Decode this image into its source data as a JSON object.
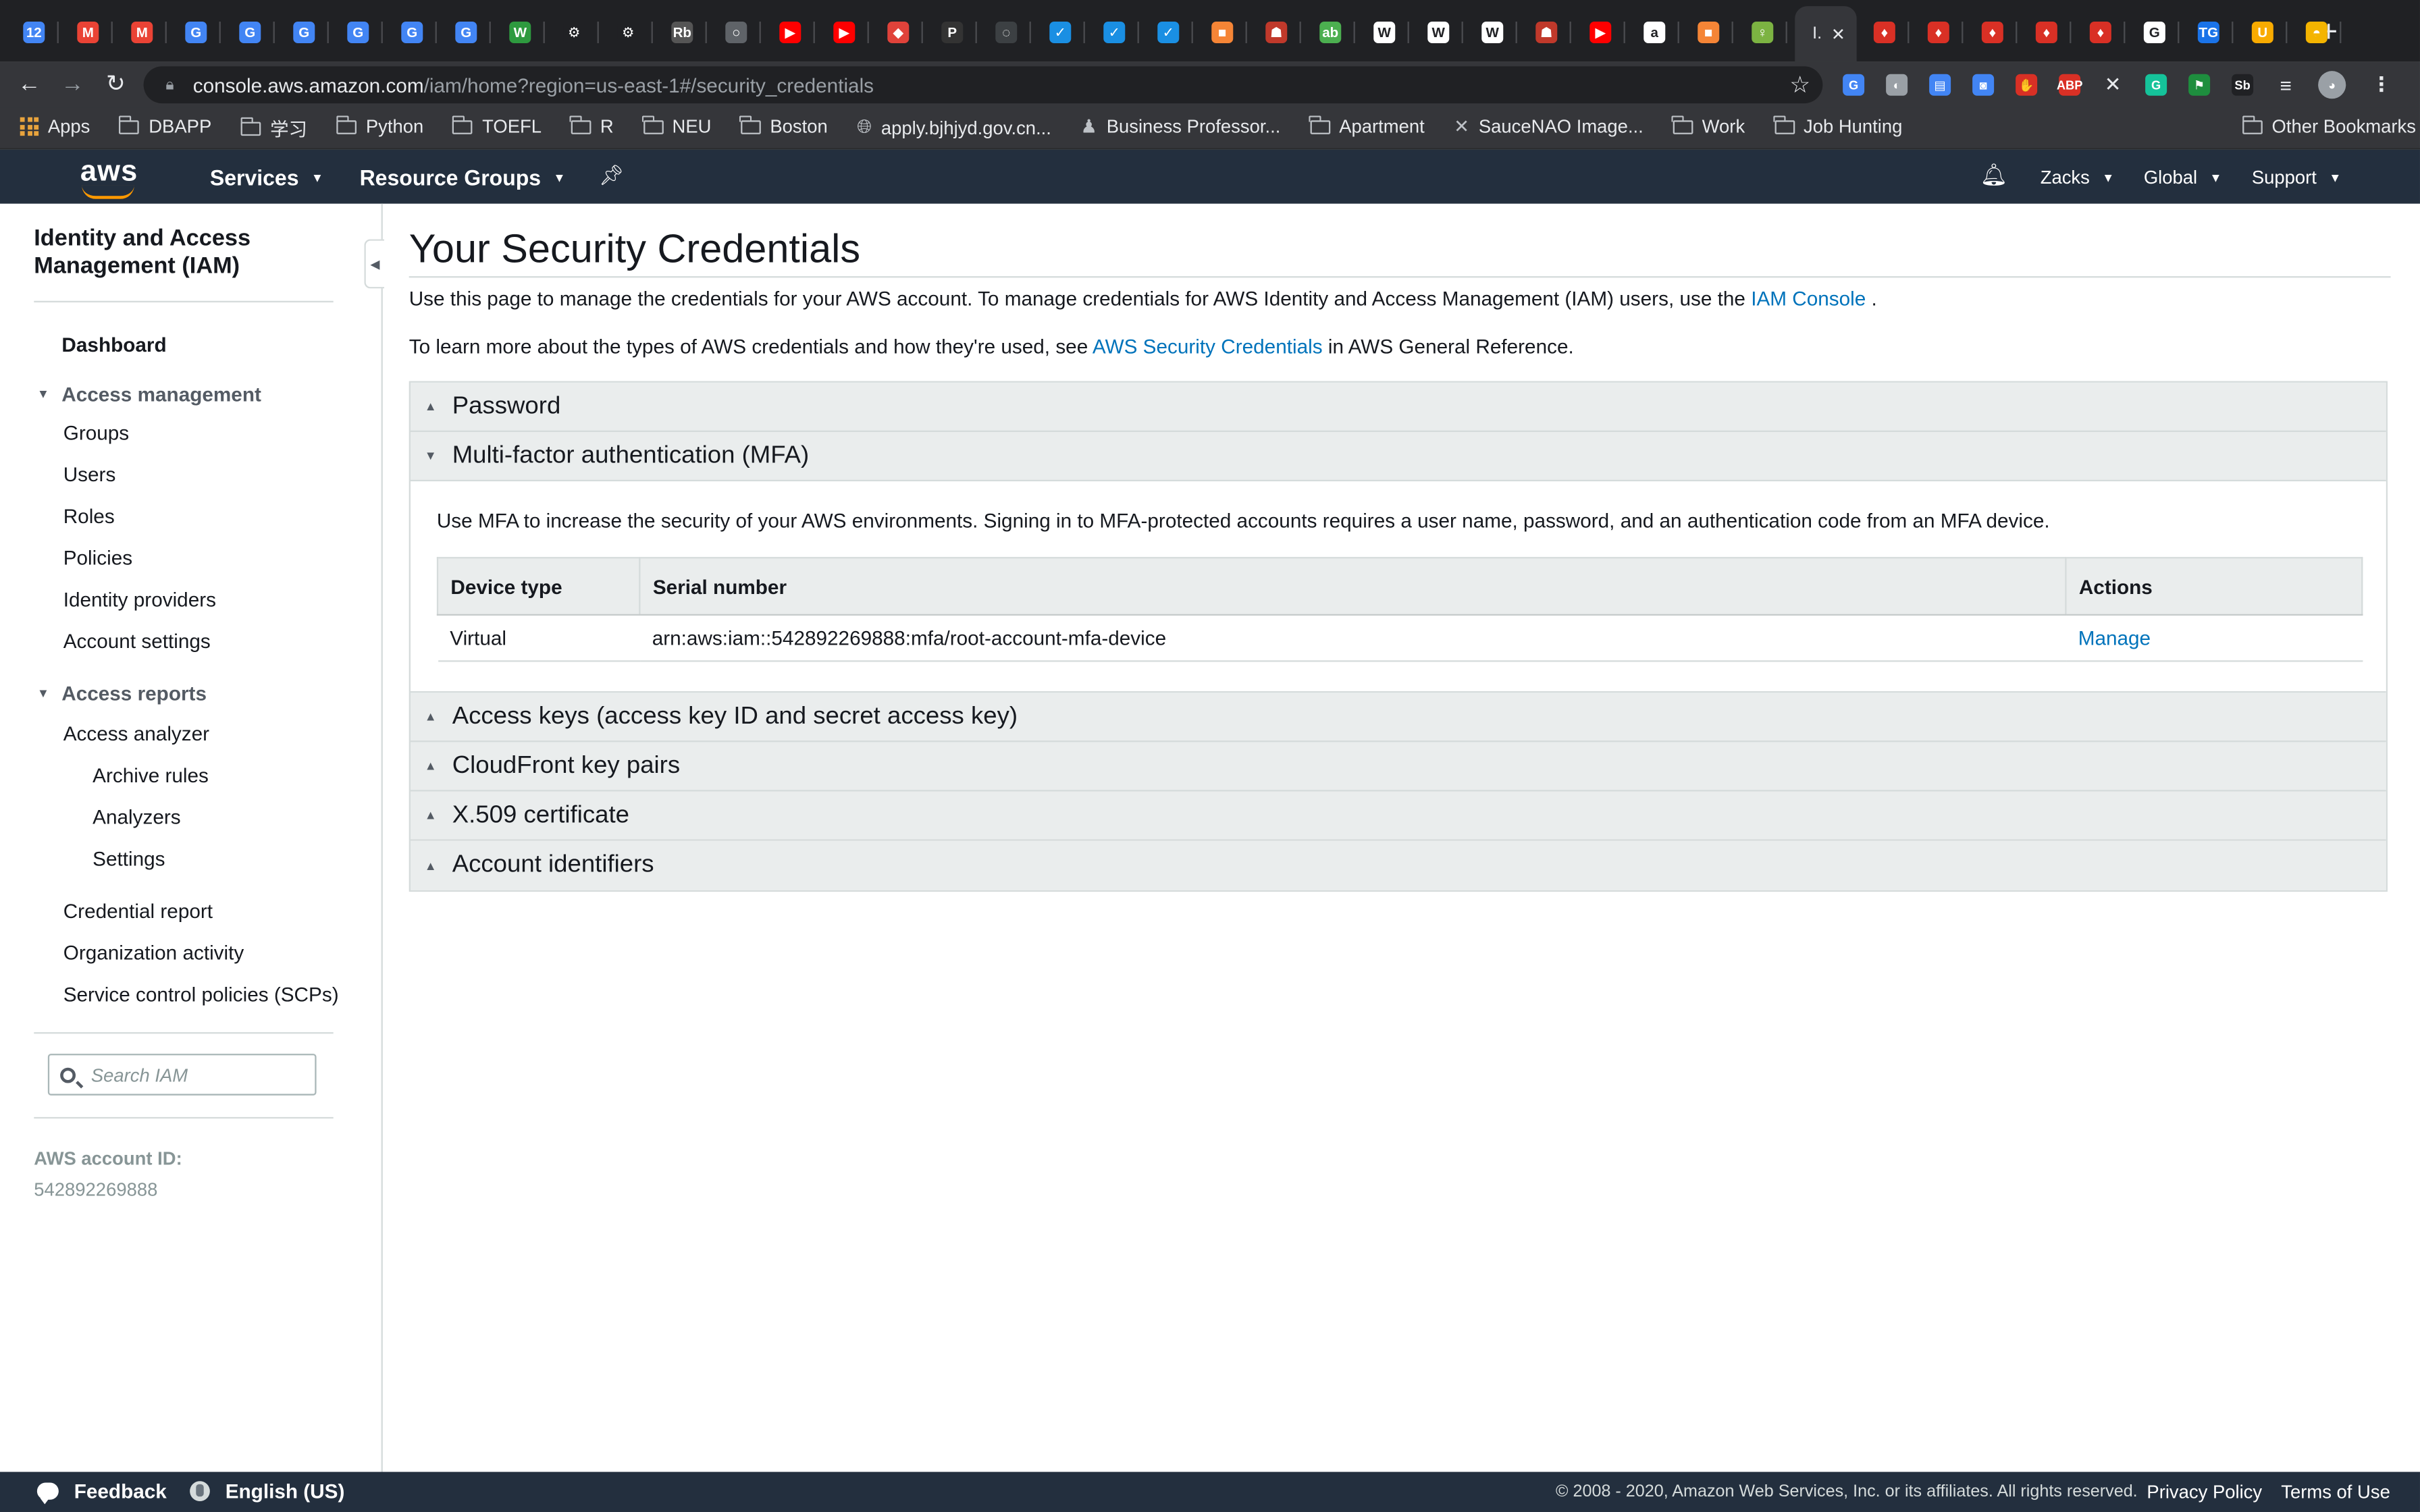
{
  "browser": {
    "tabs": [
      {
        "icon": "calendar-icon",
        "color": "#4285f4",
        "glyph": "12"
      },
      {
        "icon": "gmail-icon",
        "color": "#ea4335",
        "glyph": "M"
      },
      {
        "icon": "gmail-icon",
        "color": "#ea4335",
        "glyph": "M"
      },
      {
        "icon": "google-translate-icon",
        "color": "#4285f4",
        "glyph": "G"
      },
      {
        "icon": "google-translate-icon",
        "color": "#4285f4",
        "glyph": "G"
      },
      {
        "icon": "google-translate-icon",
        "color": "#4285f4",
        "glyph": "G"
      },
      {
        "icon": "google-translate-icon",
        "color": "#4285f4",
        "glyph": "G"
      },
      {
        "icon": "google-translate-icon",
        "color": "#4285f4",
        "glyph": "G"
      },
      {
        "icon": "google-translate-icon",
        "color": "#4285f4",
        "glyph": "G"
      },
      {
        "icon": "wordpress-icon",
        "color": "#2e9a3f",
        "glyph": "W"
      },
      {
        "icon": "chatgpt-icon",
        "color": "#202124",
        "glyph": "⚙"
      },
      {
        "icon": "chatgpt-icon",
        "color": "#202124",
        "glyph": "⚙"
      },
      {
        "icon": "reading-icon",
        "color": "#555555",
        "glyph": "Rb"
      },
      {
        "icon": "globe-tab-icon",
        "color": "#5f6368",
        "glyph": "○"
      },
      {
        "icon": "youtube-icon",
        "color": "#ff0000",
        "glyph": "▶"
      },
      {
        "icon": "youtube-icon",
        "color": "#ff0000",
        "glyph": "▶"
      },
      {
        "icon": "layers-icon",
        "color": "#e0423a",
        "glyph": "◆"
      },
      {
        "icon": "pinterest-icon",
        "color": "#333333",
        "glyph": "P"
      },
      {
        "icon": "loading-icon",
        "color": "#3c4043",
        "glyph": "◌"
      },
      {
        "icon": "shield-tab-icon",
        "color": "#1a8fe3",
        "glyph": "✓"
      },
      {
        "icon": "shield-tab-icon",
        "color": "#1a8fe3",
        "glyph": "✓"
      },
      {
        "icon": "shield-tab-icon",
        "color": "#1a8fe3",
        "glyph": "✓"
      },
      {
        "icon": "aws-cube-icon",
        "color": "#f58536",
        "glyph": "■"
      },
      {
        "icon": "game-icon",
        "color": "#c0392b",
        "glyph": "☗"
      },
      {
        "icon": "grammar-icon",
        "color": "#4caf50",
        "glyph": "ab"
      },
      {
        "icon": "wikipedia-icon",
        "color": "#ffffff",
        "glyph": "W"
      },
      {
        "icon": "wikipedia-icon",
        "color": "#ffffff",
        "glyph": "W"
      },
      {
        "icon": "wikipedia-icon",
        "color": "#ffffff",
        "glyph": "W"
      },
      {
        "icon": "game-icon",
        "color": "#c0392b",
        "glyph": "☗"
      },
      {
        "icon": "youtube-icon",
        "color": "#ff0000",
        "glyph": "▶"
      },
      {
        "icon": "amazon-icon",
        "color": "#ffffff",
        "glyph": "a"
      },
      {
        "icon": "aws-cube-icon",
        "color": "#f58536",
        "glyph": "■"
      },
      {
        "icon": "key-icon",
        "color": "#7cb342",
        "glyph": "♀"
      }
    ],
    "active_tab": {
      "title": "I."
    },
    "tabs_after": [
      {
        "icon": "flame-icon",
        "color": "#d93025",
        "glyph": "♦"
      },
      {
        "icon": "flame-icon",
        "color": "#d93025",
        "glyph": "♦"
      },
      {
        "icon": "flame-icon",
        "color": "#d93025",
        "glyph": "♦"
      },
      {
        "icon": "flame-icon",
        "color": "#d93025",
        "glyph": "♦"
      },
      {
        "icon": "flame-icon",
        "color": "#d93025",
        "glyph": "♦"
      },
      {
        "icon": "google-icon",
        "color": "#ffffff",
        "glyph": "G"
      },
      {
        "icon": "tg-icon",
        "color": "#1a73e8",
        "glyph": "TG"
      },
      {
        "icon": "ug-icon",
        "color": "#f9ab00",
        "glyph": "U"
      },
      {
        "icon": "food-icon",
        "color": "#f4b400",
        "glyph": "◓"
      }
    ],
    "new_tab_glyph": "+",
    "url_host": "console.aws.amazon.com",
    "url_path": "/iam/home?region=us-east-1#/security_credentials",
    "extensions": [
      {
        "icon": "translate-ext-icon",
        "color": "#4285f4",
        "glyph": "G"
      },
      {
        "icon": "bulb-ext-icon",
        "color": "#9aa0a6",
        "glyph": "◐"
      },
      {
        "icon": "calendar-ext-icon",
        "color": "#4285f4",
        "glyph": "▤"
      },
      {
        "icon": "screenshot-ext-icon",
        "color": "#4285f4",
        "glyph": "◙"
      },
      {
        "icon": "hand-ext-icon",
        "color": "#d93025",
        "glyph": "✋"
      },
      {
        "icon": "adblock-ext-icon",
        "color": "#d93025",
        "glyph": "ABP"
      },
      {
        "icon": "x-ext-icon",
        "color": "#35363a",
        "glyph": "✕"
      },
      {
        "icon": "grammarly-ext-icon",
        "color": "#15c39a",
        "glyph": "G"
      },
      {
        "icon": "green-ext-icon",
        "color": "#1e8e3e",
        "glyph": "⚑"
      },
      {
        "icon": "sb-ext-icon",
        "color": "#202124",
        "glyph": "Sb"
      },
      {
        "icon": "playlist-ext-icon",
        "color": "#35363a",
        "glyph": "≡"
      },
      {
        "icon": "profile-avatar-icon",
        "color": "#9aa0a6",
        "glyph": "◕"
      },
      {
        "icon": "kebab-menu-icon",
        "color": "#35363a",
        "glyph": "⋮"
      }
    ],
    "bookmarks": [
      {
        "label": "Apps",
        "type": "apps"
      },
      {
        "label": "DBAPP",
        "type": "folder"
      },
      {
        "label": "学习",
        "type": "folder"
      },
      {
        "label": "Python",
        "type": "folder"
      },
      {
        "label": "TOEFL",
        "type": "folder"
      },
      {
        "label": "R",
        "type": "folder"
      },
      {
        "label": "NEU",
        "type": "folder"
      },
      {
        "label": "Boston",
        "type": "folder"
      },
      {
        "label": "apply.bjhjyd.gov.cn...",
        "type": "globe"
      },
      {
        "label": "Business Professor...",
        "type": "site"
      },
      {
        "label": "Apartment",
        "type": "folder"
      },
      {
        "label": "SauceNAO Image...",
        "type": "x"
      },
      {
        "label": "Work",
        "type": "folder"
      },
      {
        "label": "Job Hunting",
        "type": "folder"
      }
    ],
    "other_bookmarks": "Other Bookmarks"
  },
  "aws_nav": {
    "logo": "aws",
    "services": "Services",
    "resource_groups": "Resource Groups",
    "user": "Zacks",
    "region": "Global",
    "support": "Support"
  },
  "sidebar": {
    "title": "Identity and Access Management (IAM)",
    "dashboard": "Dashboard",
    "access_management": {
      "label": "Access management",
      "items": [
        "Groups",
        "Users",
        "Roles",
        "Policies",
        "Identity providers",
        "Account settings"
      ]
    },
    "access_reports": {
      "label": "Access reports",
      "analyzer": "Access analyzer",
      "analyzer_children": [
        "Archive rules",
        "Analyzers",
        "Settings"
      ],
      "items": [
        "Credential report",
        "Organization activity",
        "Service control policies (SCPs)"
      ]
    },
    "search_placeholder": "Search IAM",
    "account_id_label": "AWS account ID:",
    "account_id": "542892269888"
  },
  "main": {
    "title": "Your Security Credentials",
    "intro1_prefix": "Use this page to manage the credentials for your AWS account. To manage credentials for AWS Identity and Access Management (IAM) users, use the ",
    "intro1_link": "IAM Console",
    "intro1_suffix": " .",
    "intro2_prefix": "To learn more about the types of AWS credentials and how they're used, see ",
    "intro2_link": "AWS Security Credentials",
    "intro2_suffix": " in AWS General Reference.",
    "sections": {
      "password": "Password",
      "mfa": "Multi-factor authentication (MFA)",
      "access_keys": "Access keys (access key ID and secret access key)",
      "cloudfront": "CloudFront key pairs",
      "x509": "X.509 certificate",
      "account_ids": "Account identifiers"
    },
    "mfa_description": "Use MFA to increase the security of your AWS environments. Signing in to MFA-protected accounts requires a user name, password, and an authentication code from an MFA device.",
    "mfa_table": {
      "headers": [
        "Device type",
        "Serial number",
        "Actions"
      ],
      "rows": [
        {
          "device_type": "Virtual",
          "serial": "arn:aws:iam::542892269888:mfa/root-account-mfa-device",
          "action": "Manage"
        }
      ]
    }
  },
  "footer": {
    "feedback": "Feedback",
    "language": "English (US)",
    "copyright": "© 2008 - 2020, Amazon Web Services, Inc. or its affiliates. All rights reserved.",
    "privacy": "Privacy Policy",
    "terms": "Terms of Use"
  }
}
